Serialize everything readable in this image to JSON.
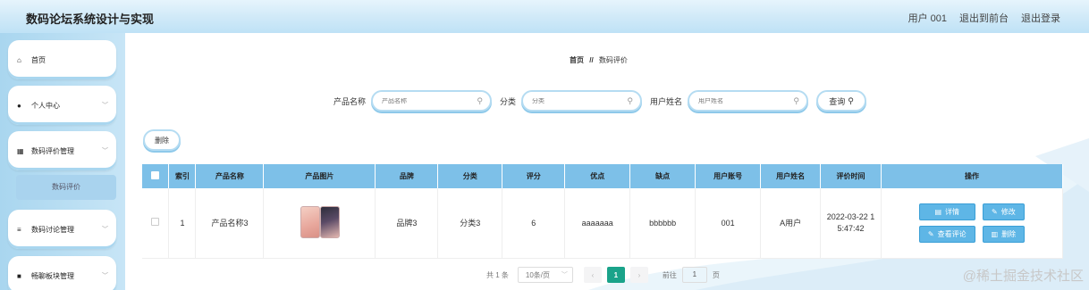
{
  "header": {
    "title": "数码论坛系统设计与实现",
    "user": "用户 001",
    "back_to_front": "退出到前台",
    "logout": "退出登录"
  },
  "sidebar": {
    "items": [
      {
        "label": "首页",
        "icon": "home-icon",
        "glyph": "⌂"
      },
      {
        "label": "个人中心",
        "icon": "user-icon",
        "glyph": "●"
      },
      {
        "label": "数码评价管理",
        "icon": "grid-icon",
        "glyph": "▦"
      },
      {
        "label": "数码讨论管理",
        "icon": "list-icon",
        "glyph": "≡"
      },
      {
        "label": "畅聊板块管理",
        "icon": "book-icon",
        "glyph": "■"
      }
    ],
    "submenu_active": "数码评价"
  },
  "breadcrumb": {
    "home": "首页",
    "sep": "//",
    "current": "数码评价"
  },
  "search": {
    "product_name_label": "产品名称",
    "product_name_placeholder": "产品名称",
    "category_label": "分类",
    "category_placeholder": "分类",
    "username_label": "用户姓名",
    "username_placeholder": "用户姓名",
    "query_label": "查询"
  },
  "toolbar": {
    "delete_label": "删除"
  },
  "table": {
    "columns": [
      "索引",
      "产品名称",
      "产品图片",
      "品牌",
      "分类",
      "评分",
      "优点",
      "缺点",
      "用户账号",
      "用户姓名",
      "评价时间",
      "操作"
    ],
    "rows": [
      {
        "index": "1",
        "product_name": "产品名称3",
        "brand": "品牌3",
        "category": "分类3",
        "score": "6",
        "pros": "aaaaaaa",
        "cons": "bbbbbb",
        "account": "001",
        "username": "A用户",
        "time_line1": "2022-03-22 1",
        "time_line2": "5:47:42",
        "actions": {
          "detail": "详情",
          "edit": "修改",
          "view_comments": "查看评论",
          "delete": "删除"
        }
      }
    ]
  },
  "pagination": {
    "total": "共 1 条",
    "page_size": "10条/页",
    "current_page": "1",
    "goto_label": "前往",
    "goto_value": "1",
    "page_unit": "页"
  },
  "watermark": "@稀土掘金技术社区",
  "colors": {
    "accent": "#7dc0e8",
    "button": "#5eb6e6",
    "active_page": "#1aa38a"
  }
}
